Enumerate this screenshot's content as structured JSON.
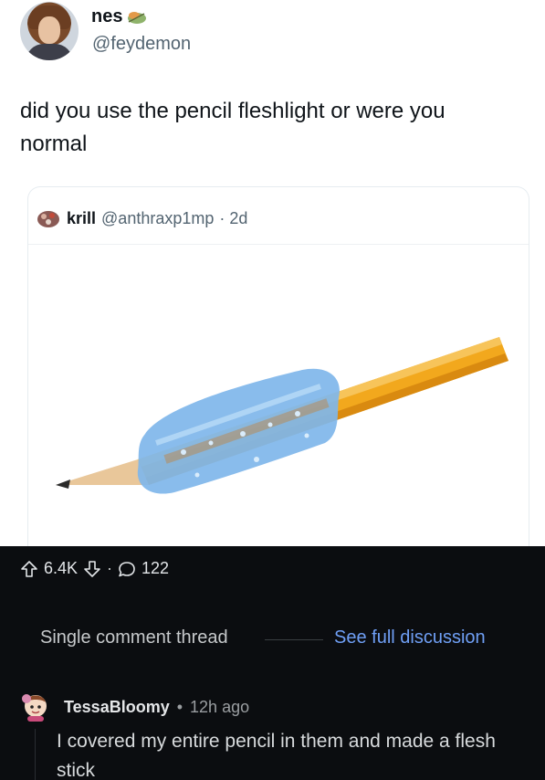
{
  "tweet": {
    "display_name": "nes",
    "handle": "@feydemon",
    "text": "did you use the pencil fleshlight or were you normal",
    "name_emoji_icon": "leaf-icon"
  },
  "quote": {
    "display_name": "krill",
    "handle": "@anthraxp1mp",
    "age": "· 2d",
    "image_subject": "pencil-with-blue-grip"
  },
  "post_stats": {
    "upvotes": "6.4K",
    "separator": "·",
    "comments": "122"
  },
  "thread": {
    "single_label": "Single comment thread",
    "see_full_label": "See full discussion"
  },
  "comment": {
    "username": "TessaBloomy",
    "separator": "•",
    "time": "12h ago",
    "text": "I covered my entire pencil in them and made a flesh stick"
  },
  "colors": {
    "dark_bg": "#0b0d10",
    "link_blue": "#6f9ff5",
    "pencil_yellow": "#f2a81d",
    "grip_blue": "#7fb6ea"
  }
}
